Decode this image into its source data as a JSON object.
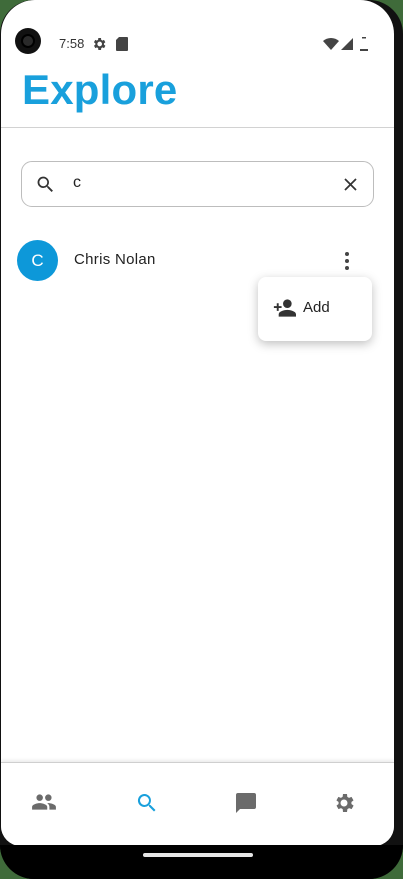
{
  "status_bar": {
    "time": "7:58",
    "icons": [
      "gear-icon",
      "sd-card-icon",
      "wifi-icon",
      "signal-icon",
      "battery-icon"
    ]
  },
  "header": {
    "title": "Explore"
  },
  "search": {
    "value": "c",
    "icons": [
      "search-icon",
      "clear-icon"
    ]
  },
  "results": [
    {
      "initial": "C",
      "name": "Chris Nolan",
      "avatar_color": "#0d98d9"
    }
  ],
  "popup_menu": {
    "items": [
      {
        "label": "Add",
        "icon": "person-add-icon"
      }
    ]
  },
  "bottom_nav": {
    "items": [
      {
        "icon": "people-icon",
        "active": false
      },
      {
        "icon": "search-icon",
        "active": true
      },
      {
        "icon": "chat-icon",
        "active": false
      },
      {
        "icon": "settings-icon",
        "active": false
      }
    ],
    "active_color": "#19a0dc",
    "inactive_color": "#6b6b6b"
  },
  "colors": {
    "accent": "#19a0dc",
    "text": "#222222"
  }
}
